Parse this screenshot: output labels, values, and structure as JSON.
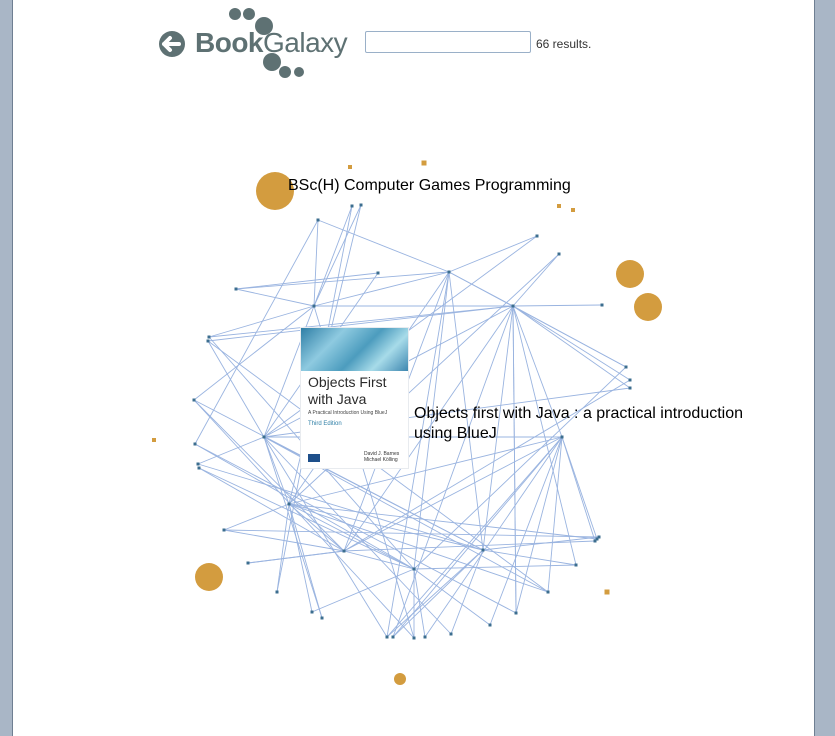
{
  "header": {
    "logo_bold": "Book",
    "logo_light": "Galaxy",
    "search": {
      "value": "",
      "placeholder": ""
    },
    "results": "66 results."
  },
  "labels": {
    "group_title": "BSc(H) Computer Games Programming",
    "selected_line1": "Objects first with Java : a practical introduction",
    "selected_line2": "using BlueJ"
  },
  "book_cover": {
    "title_line1": "Objects First",
    "title_line2": "with Java",
    "subtitle": "A Practical Introduction Using BlueJ",
    "edition": "Third Edition",
    "author1": "David J. Barnes",
    "author2": "Michael Kölling"
  },
  "colors": {
    "logo": "#5e7173",
    "edge": "#9ab4e0",
    "node": "#3c6e8f",
    "orbit": "#d39c3f"
  }
}
